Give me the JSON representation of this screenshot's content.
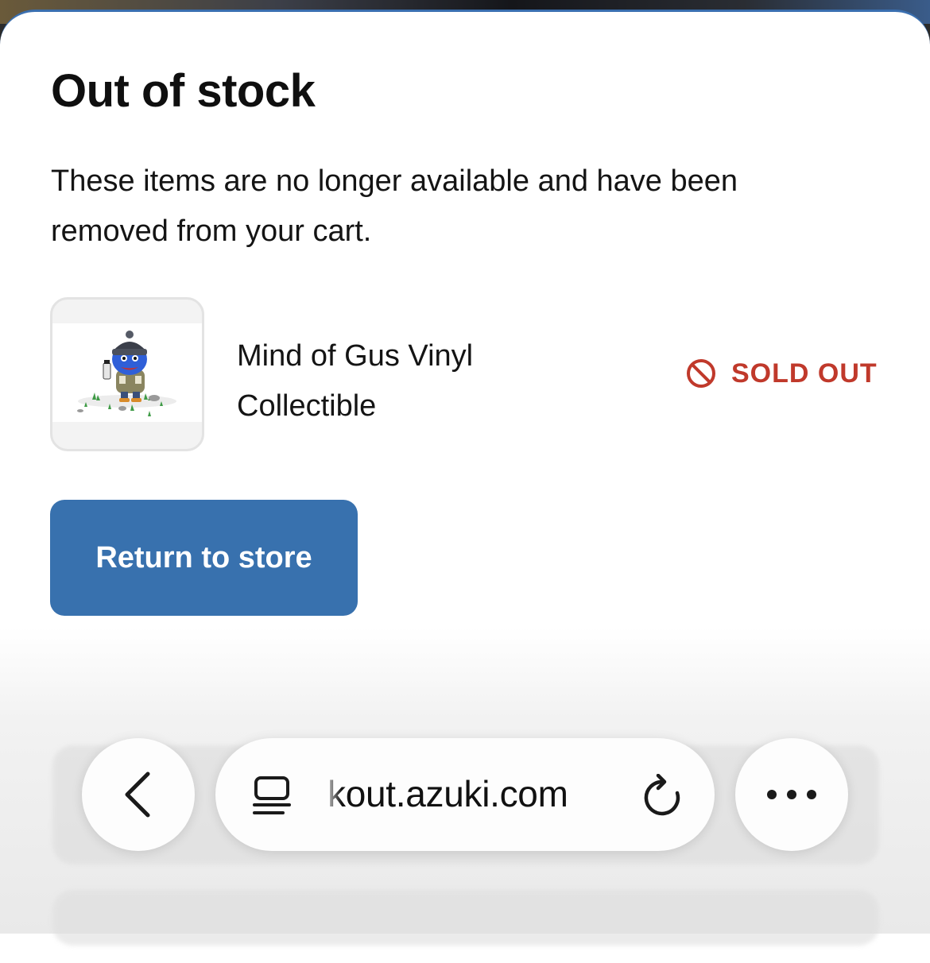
{
  "sheet": {
    "title": "Out of stock",
    "description": "These items are no longer available and have been removed from your cart."
  },
  "item": {
    "name": "Mind of Gus Vinyl Collectible",
    "status": "SOLD OUT",
    "status_icon": "prohibited-icon",
    "thumbnail_icon": "vinyl-figure-image"
  },
  "actions": {
    "return_label": "Return to store"
  },
  "browser": {
    "url": "kout.azuki.com",
    "back_icon": "chevron-left-icon",
    "page_menu_icon": "page-menu-icon",
    "reload_icon": "reload-icon",
    "more_icon": "more-icon"
  },
  "colors": {
    "accent": "#3871ae",
    "sold_out": "#c0392b"
  }
}
